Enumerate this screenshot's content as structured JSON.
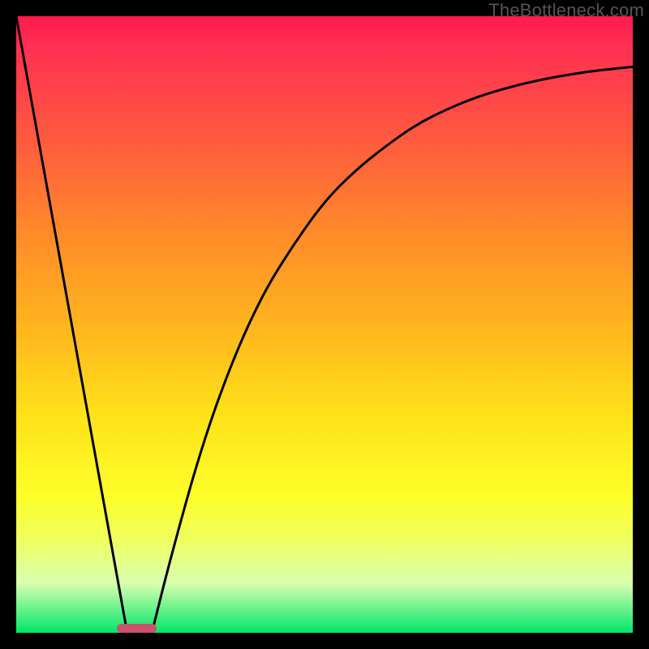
{
  "watermark": "TheBottleneck.com",
  "chart_data": {
    "type": "line",
    "title": "",
    "xlabel": "",
    "ylabel": "",
    "xlim": [
      0,
      100
    ],
    "ylim": [
      0,
      100
    ],
    "grid": false,
    "series": [
      {
        "name": "left-falling-line",
        "x": [
          0,
          18
        ],
        "values": [
          100,
          0
        ]
      },
      {
        "name": "right-rising-curve",
        "x": [
          22,
          25,
          30,
          35,
          40,
          45,
          50,
          55,
          60,
          65,
          70,
          75,
          80,
          85,
          90,
          95,
          100
        ],
        "values": [
          0,
          12,
          30,
          44,
          55,
          63,
          70,
          75,
          79,
          82.5,
          85,
          87,
          88.5,
          89.7,
          90.6,
          91.3,
          91.8
        ]
      }
    ],
    "marker": {
      "name": "bottleneck-marker",
      "x_center_pct": 19.5,
      "y_pct": 0,
      "width_pct": 6.5,
      "height_pct": 1.4,
      "color": "#c9536a"
    },
    "background_gradient": {
      "top": "#ff1a4d",
      "mid": "#ffe21a",
      "bottom": "#00e66a"
    }
  }
}
